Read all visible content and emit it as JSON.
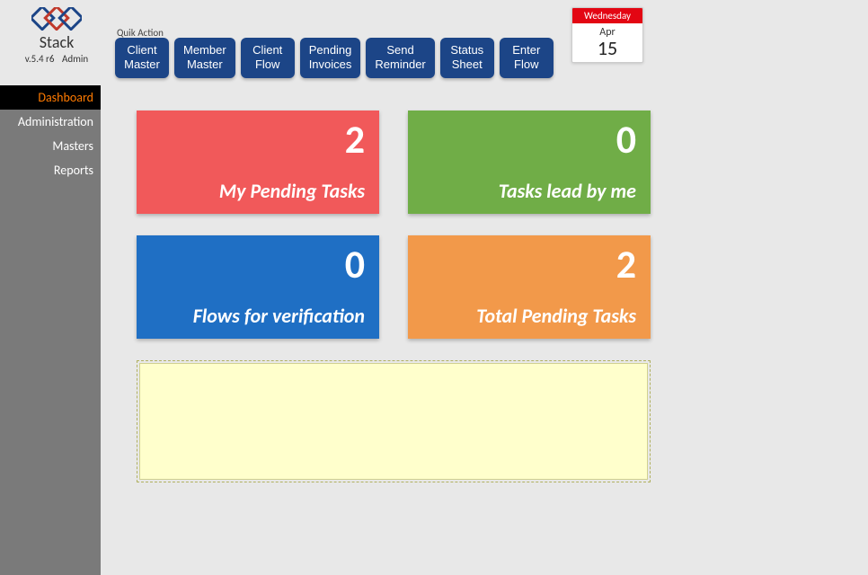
{
  "brand": {
    "title": "Stack",
    "version": "v.5.4 r6",
    "role": "Admin"
  },
  "quick_action_label": "Quik Action",
  "quick_actions": {
    "client_master": "Client\nMaster",
    "member_master": "Member\nMaster",
    "client_flow": "Client\nFlow",
    "pending_invoices": "Pending\nInvoices",
    "send_reminder": "Send\nReminder",
    "status_sheet": "Status\nSheet",
    "enter_flow": "Enter\nFlow"
  },
  "calendar": {
    "day": "Wednesday",
    "month": "Apr",
    "date": "15"
  },
  "sidebar": {
    "items": [
      {
        "label": "Dashboard"
      },
      {
        "label": "Administration"
      },
      {
        "label": "Masters"
      },
      {
        "label": "Reports"
      }
    ]
  },
  "cards": {
    "my_pending": {
      "value": "2",
      "label": "My Pending Tasks"
    },
    "lead_by_me": {
      "value": "0",
      "label": "Tasks lead by me"
    },
    "flows_verify": {
      "value": "0",
      "label": "Flows for verification"
    },
    "total_pending": {
      "value": "2",
      "label": "Total Pending Tasks"
    }
  },
  "notes": ""
}
